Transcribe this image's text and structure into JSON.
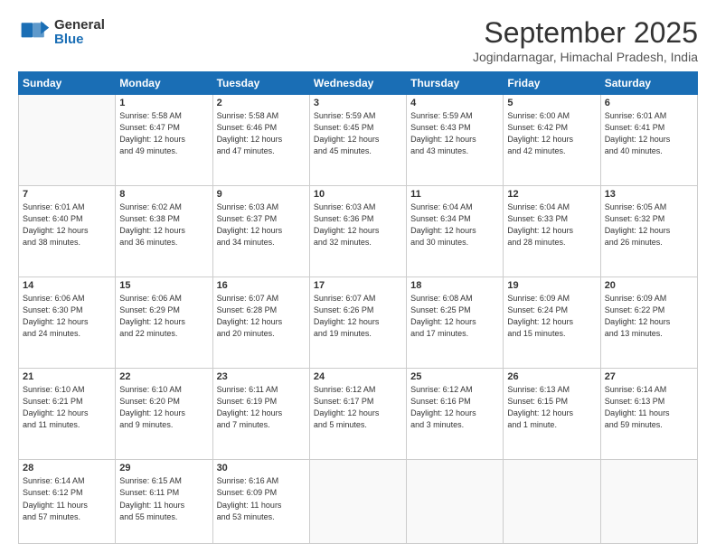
{
  "header": {
    "logo_general": "General",
    "logo_blue": "Blue",
    "month_title": "September 2025",
    "subtitle": "Jogindarnagar, Himachal Pradesh, India"
  },
  "days_of_week": [
    "Sunday",
    "Monday",
    "Tuesday",
    "Wednesday",
    "Thursday",
    "Friday",
    "Saturday"
  ],
  "weeks": [
    [
      {
        "day": "",
        "info": ""
      },
      {
        "day": "1",
        "info": "Sunrise: 5:58 AM\nSunset: 6:47 PM\nDaylight: 12 hours\nand 49 minutes."
      },
      {
        "day": "2",
        "info": "Sunrise: 5:58 AM\nSunset: 6:46 PM\nDaylight: 12 hours\nand 47 minutes."
      },
      {
        "day": "3",
        "info": "Sunrise: 5:59 AM\nSunset: 6:45 PM\nDaylight: 12 hours\nand 45 minutes."
      },
      {
        "day": "4",
        "info": "Sunrise: 5:59 AM\nSunset: 6:43 PM\nDaylight: 12 hours\nand 43 minutes."
      },
      {
        "day": "5",
        "info": "Sunrise: 6:00 AM\nSunset: 6:42 PM\nDaylight: 12 hours\nand 42 minutes."
      },
      {
        "day": "6",
        "info": "Sunrise: 6:01 AM\nSunset: 6:41 PM\nDaylight: 12 hours\nand 40 minutes."
      }
    ],
    [
      {
        "day": "7",
        "info": "Sunrise: 6:01 AM\nSunset: 6:40 PM\nDaylight: 12 hours\nand 38 minutes."
      },
      {
        "day": "8",
        "info": "Sunrise: 6:02 AM\nSunset: 6:38 PM\nDaylight: 12 hours\nand 36 minutes."
      },
      {
        "day": "9",
        "info": "Sunrise: 6:03 AM\nSunset: 6:37 PM\nDaylight: 12 hours\nand 34 minutes."
      },
      {
        "day": "10",
        "info": "Sunrise: 6:03 AM\nSunset: 6:36 PM\nDaylight: 12 hours\nand 32 minutes."
      },
      {
        "day": "11",
        "info": "Sunrise: 6:04 AM\nSunset: 6:34 PM\nDaylight: 12 hours\nand 30 minutes."
      },
      {
        "day": "12",
        "info": "Sunrise: 6:04 AM\nSunset: 6:33 PM\nDaylight: 12 hours\nand 28 minutes."
      },
      {
        "day": "13",
        "info": "Sunrise: 6:05 AM\nSunset: 6:32 PM\nDaylight: 12 hours\nand 26 minutes."
      }
    ],
    [
      {
        "day": "14",
        "info": "Sunrise: 6:06 AM\nSunset: 6:30 PM\nDaylight: 12 hours\nand 24 minutes."
      },
      {
        "day": "15",
        "info": "Sunrise: 6:06 AM\nSunset: 6:29 PM\nDaylight: 12 hours\nand 22 minutes."
      },
      {
        "day": "16",
        "info": "Sunrise: 6:07 AM\nSunset: 6:28 PM\nDaylight: 12 hours\nand 20 minutes."
      },
      {
        "day": "17",
        "info": "Sunrise: 6:07 AM\nSunset: 6:26 PM\nDaylight: 12 hours\nand 19 minutes."
      },
      {
        "day": "18",
        "info": "Sunrise: 6:08 AM\nSunset: 6:25 PM\nDaylight: 12 hours\nand 17 minutes."
      },
      {
        "day": "19",
        "info": "Sunrise: 6:09 AM\nSunset: 6:24 PM\nDaylight: 12 hours\nand 15 minutes."
      },
      {
        "day": "20",
        "info": "Sunrise: 6:09 AM\nSunset: 6:22 PM\nDaylight: 12 hours\nand 13 minutes."
      }
    ],
    [
      {
        "day": "21",
        "info": "Sunrise: 6:10 AM\nSunset: 6:21 PM\nDaylight: 12 hours\nand 11 minutes."
      },
      {
        "day": "22",
        "info": "Sunrise: 6:10 AM\nSunset: 6:20 PM\nDaylight: 12 hours\nand 9 minutes."
      },
      {
        "day": "23",
        "info": "Sunrise: 6:11 AM\nSunset: 6:19 PM\nDaylight: 12 hours\nand 7 minutes."
      },
      {
        "day": "24",
        "info": "Sunrise: 6:12 AM\nSunset: 6:17 PM\nDaylight: 12 hours\nand 5 minutes."
      },
      {
        "day": "25",
        "info": "Sunrise: 6:12 AM\nSunset: 6:16 PM\nDaylight: 12 hours\nand 3 minutes."
      },
      {
        "day": "26",
        "info": "Sunrise: 6:13 AM\nSunset: 6:15 PM\nDaylight: 12 hours\nand 1 minute."
      },
      {
        "day": "27",
        "info": "Sunrise: 6:14 AM\nSunset: 6:13 PM\nDaylight: 11 hours\nand 59 minutes."
      }
    ],
    [
      {
        "day": "28",
        "info": "Sunrise: 6:14 AM\nSunset: 6:12 PM\nDaylight: 11 hours\nand 57 minutes."
      },
      {
        "day": "29",
        "info": "Sunrise: 6:15 AM\nSunset: 6:11 PM\nDaylight: 11 hours\nand 55 minutes."
      },
      {
        "day": "30",
        "info": "Sunrise: 6:16 AM\nSunset: 6:09 PM\nDaylight: 11 hours\nand 53 minutes."
      },
      {
        "day": "",
        "info": ""
      },
      {
        "day": "",
        "info": ""
      },
      {
        "day": "",
        "info": ""
      },
      {
        "day": "",
        "info": ""
      }
    ]
  ]
}
